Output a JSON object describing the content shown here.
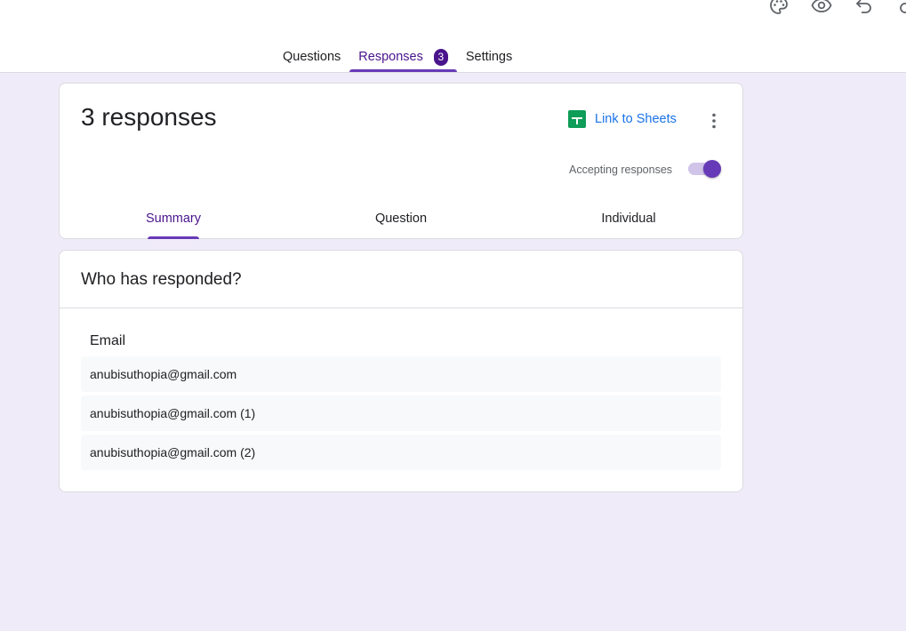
{
  "top_icons": [
    "palette-icon",
    "preview-eye-icon",
    "undo-icon",
    "redo-icon"
  ],
  "tabs": [
    {
      "label": "Questions",
      "active": false
    },
    {
      "label": "Responses",
      "active": true,
      "badge": "3"
    },
    {
      "label": "Settings",
      "active": false
    }
  ],
  "summary_card": {
    "title": "3 responses",
    "link_sheets_label": "Link to Sheets",
    "accepting_label": "Accepting responses",
    "accepting_on": true,
    "subtabs": [
      {
        "label": "Summary",
        "active": true
      },
      {
        "label": "Question",
        "active": false
      },
      {
        "label": "Individual",
        "active": false
      }
    ]
  },
  "responded_card": {
    "title": "Who has responded?",
    "column_header": "Email",
    "emails": [
      "anubisuthopia@gmail.com",
      "anubisuthopia@gmail.com (1)",
      "anubisuthopia@gmail.com (2)"
    ]
  },
  "colors": {
    "accent": "#673ab7",
    "accent_dark": "#4a148c",
    "background": "#f0ebf8",
    "link": "#1a73e8",
    "sheets_green": "#0f9d58"
  }
}
